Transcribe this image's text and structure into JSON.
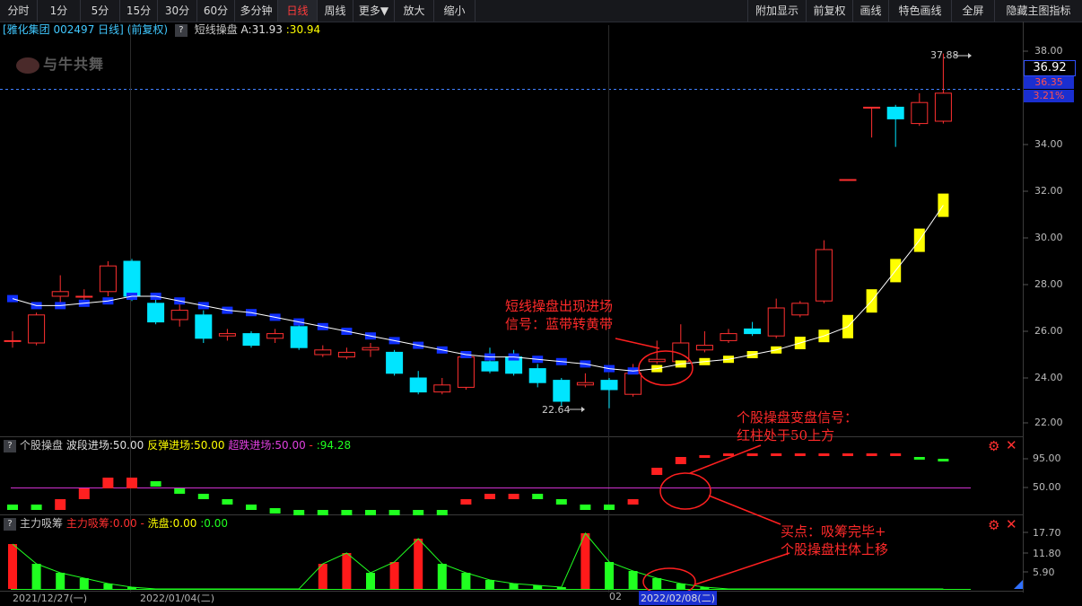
{
  "toolbar": {
    "periods": [
      "分时",
      "1分",
      "5分",
      "15分",
      "30分",
      "60分",
      "多分钟",
      "日线",
      "周线",
      "更多▼",
      "放大",
      "缩小"
    ],
    "right_items": [
      "附加显示",
      "前复权",
      "画线",
      "特色画线",
      "全屏",
      "隐藏主图指标"
    ]
  },
  "main_panel": {
    "stock_name": "[雅化集团",
    "stock_code": "002497 日线]",
    "adjust": "(前复权)",
    "indicator_name": "短线操盘",
    "indicator_a": "A:31.93",
    "indicator_b": ":30.94",
    "logo_text": "与牛共舞",
    "price_ticks": [
      "38.00",
      "36.00",
      "34.00",
      "32.00",
      "30.00",
      "28.00",
      "26.00",
      "24.00",
      "22.00"
    ],
    "current_price": "36.92",
    "ref_price": "36.35",
    "change_pct": "3.21%",
    "high_label": "37.88",
    "low_label": "22.64"
  },
  "panel2": {
    "name": "个股操盘",
    "wave_label": "波段进场:50.00",
    "rebound_label": "反弹进场:50.00",
    "oversold_label": "超跌进场:50.00",
    "value": ":94.28",
    "ticks": [
      "95.00",
      "50.00"
    ]
  },
  "panel3": {
    "name": "主力吸筹",
    "absorb_label": "主力吸筹:0.00",
    "wash_label": "洗盘:0.00",
    "value": ":0.00",
    "ticks": [
      "17.70",
      "11.80",
      "5.90"
    ]
  },
  "dates": [
    "2021/12/27(一)",
    "2022/01/04(二)",
    "02",
    "2022/02/08(二)"
  ],
  "annotations": {
    "a1_line1": "短线操盘出现进场",
    "a1_line2": "信号：蓝带转黄带",
    "a2_line1": "个股操盘变盘信号：",
    "a2_line2": "红柱处于50上方",
    "a3_line1": "买点：吸筹完毕+",
    "a3_line2": "个股操盘柱体上移"
  },
  "colors": {
    "up": "#ff3030",
    "down": "#00e5ff",
    "band_blue": "#1030ff",
    "band_yellow": "#ffff00",
    "magenta": "#d030d0",
    "green": "#20ff20"
  }
}
